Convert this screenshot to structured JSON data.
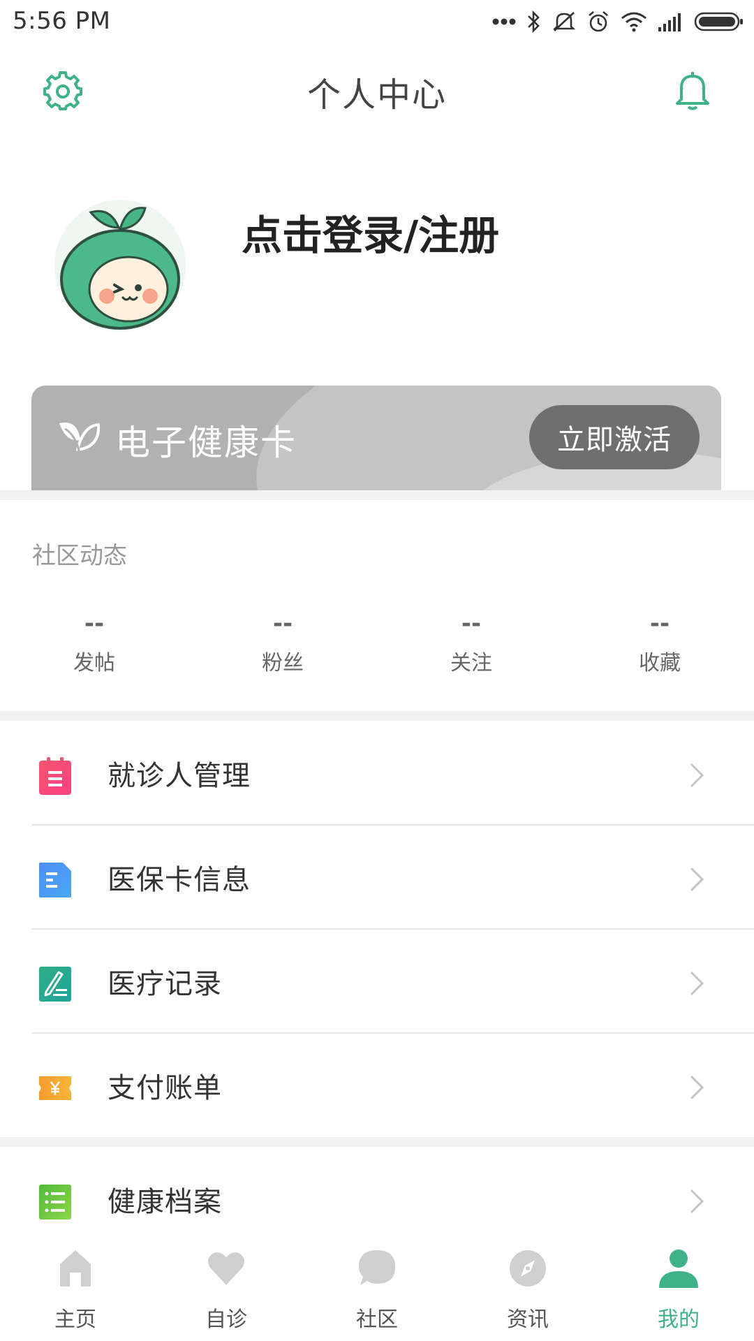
{
  "status_bar": {
    "time": "5:56 PM"
  },
  "header": {
    "title": "个人中心",
    "settings_icon": "gear-icon",
    "notification_icon": "bell-icon"
  },
  "profile": {
    "login_text": "点击登录/注册"
  },
  "health_card": {
    "title": "电子健康卡",
    "activate_label": "立即激活"
  },
  "community": {
    "title": "社区动态",
    "stats": [
      {
        "value": "--",
        "label": "发帖"
      },
      {
        "value": "--",
        "label": "粉丝"
      },
      {
        "value": "--",
        "label": "关注"
      },
      {
        "value": "--",
        "label": "收藏"
      }
    ]
  },
  "menu": [
    {
      "label": "就诊人管理",
      "icon": "calendar-icon"
    },
    {
      "label": "医保卡信息",
      "icon": "document-icon"
    },
    {
      "label": "医疗记录",
      "icon": "pen-record-icon"
    },
    {
      "label": "支付账单",
      "icon": "ticket-yen-icon"
    },
    {
      "label": "健康档案",
      "icon": "list-icon"
    }
  ],
  "tabbar": {
    "items": [
      {
        "label": "主页",
        "icon": "home-icon"
      },
      {
        "label": "自诊",
        "icon": "heart-icon"
      },
      {
        "label": "社区",
        "icon": "chat-bubble-icon"
      },
      {
        "label": "资讯",
        "icon": "compass-icon"
      },
      {
        "label": "我的",
        "icon": "person-icon"
      }
    ],
    "active_index": 4
  },
  "colors": {
    "accent": "#3fb287",
    "card_gray": "#b1b1b1",
    "button_gray": "#6f6f6f"
  }
}
